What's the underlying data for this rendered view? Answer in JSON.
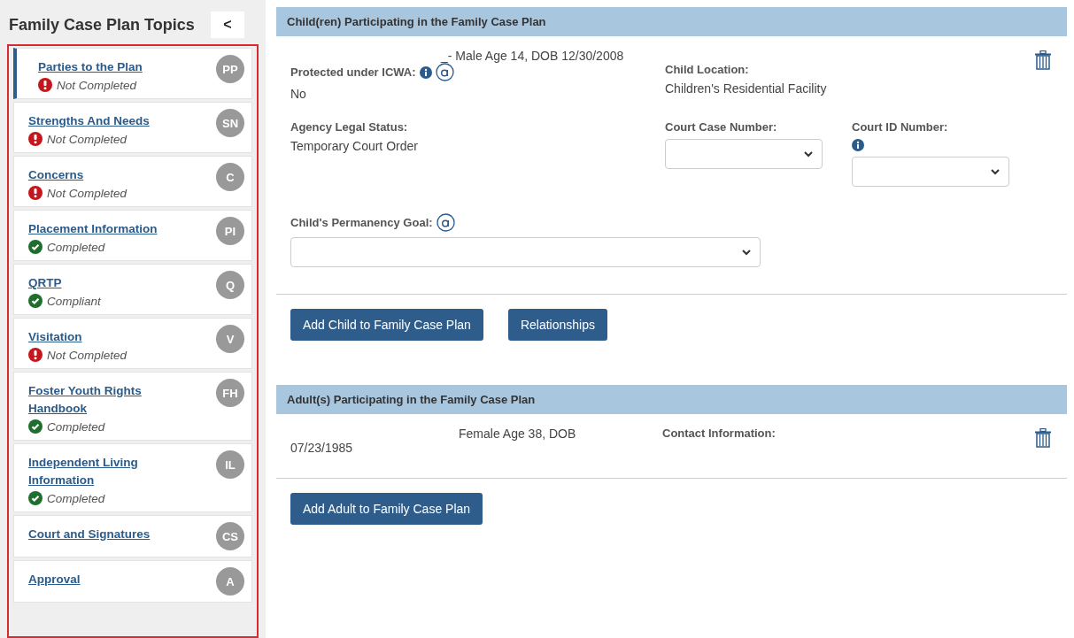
{
  "sidebar": {
    "title": "Family Case Plan Topics",
    "collapse_button": "<",
    "items": [
      {
        "label": "Parties to the Plan",
        "badge": "PP",
        "selected": true,
        "status": {
          "kind": "error",
          "text": "Not Completed"
        }
      },
      {
        "label": "Strengths And Needs",
        "badge": "SN",
        "selected": false,
        "status": {
          "kind": "error",
          "text": "Not Completed"
        }
      },
      {
        "label": "Concerns",
        "badge": "C",
        "selected": false,
        "status": {
          "kind": "error",
          "text": "Not Completed"
        }
      },
      {
        "label": "Placement Information",
        "badge": "PI",
        "selected": false,
        "status": {
          "kind": "ok",
          "text": "Completed"
        }
      },
      {
        "label": "QRTP",
        "badge": "Q",
        "selected": false,
        "status": {
          "kind": "ok",
          "text": "Compliant"
        }
      },
      {
        "label": "Visitation",
        "badge": "V",
        "selected": false,
        "status": {
          "kind": "error",
          "text": "Not Completed"
        }
      },
      {
        "label": "Foster Youth Rights Handbook",
        "badge": "FH",
        "selected": false,
        "status": {
          "kind": "ok",
          "text": "Completed"
        }
      },
      {
        "label": "Independent Living Information",
        "badge": "IL",
        "selected": false,
        "status": {
          "kind": "ok",
          "text": "Completed"
        }
      },
      {
        "label": "Court and Signatures",
        "badge": "CS",
        "selected": false
      },
      {
        "label": "Approval",
        "badge": "A",
        "selected": false
      }
    ]
  },
  "child_section": {
    "title": "Child(ren) Participating in the Family Case Plan",
    "summary": "_- Male Age 14, DOB 12/30/2008",
    "icwa": {
      "label": "Protected under ICWA:",
      "value": "No"
    },
    "location": {
      "label": "Child Location:",
      "value": "Children's Residential Facility"
    },
    "legal_status": {
      "label": "Agency Legal Status:",
      "value": "Temporary Court Order"
    },
    "court_case_number": {
      "label": "Court Case Number:"
    },
    "court_id_number": {
      "label": "Court ID Number:"
    },
    "permanency_goal": {
      "label": "Child's Permanency Goal:"
    },
    "buttons": [
      "Add Child to Family Case Plan",
      "Relationships"
    ]
  },
  "adult_section": {
    "title": "Adult(s) Participating in the Family Case Plan",
    "summary": "Female Age 38, DOB 07/23/1985",
    "contact": {
      "label": "Contact Information:"
    },
    "buttons": [
      "Add Adult to Family Case Plan"
    ]
  }
}
